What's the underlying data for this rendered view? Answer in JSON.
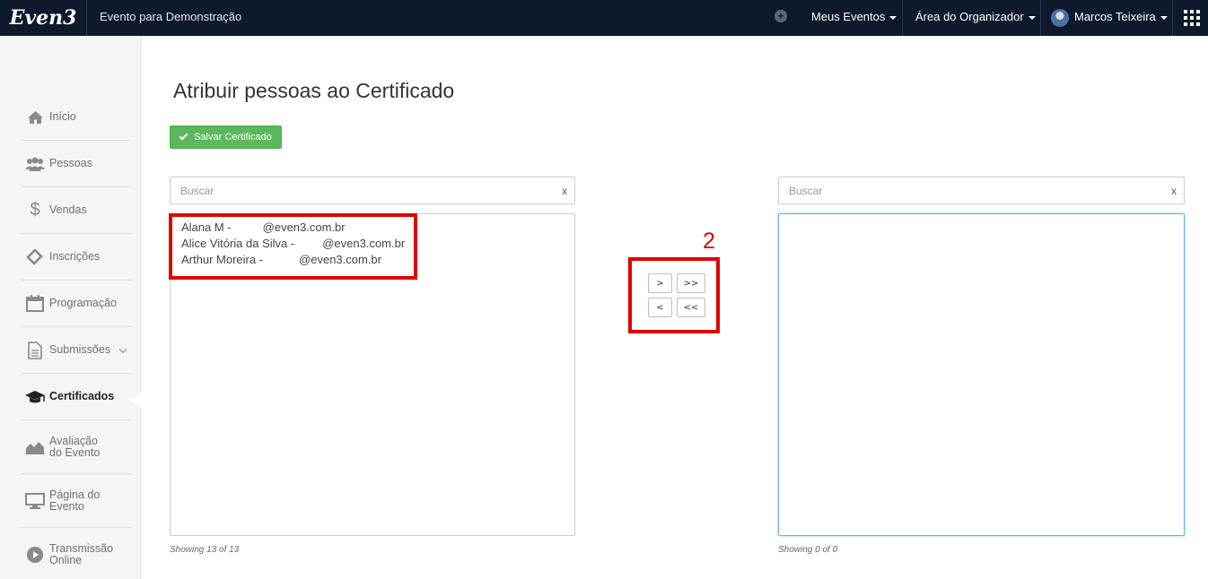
{
  "topbar": {
    "logo_text": "Even3",
    "event_title": "Evento para Demonstração",
    "nav": {
      "meus_eventos": "Meus Eventos",
      "area_organizador": "Área do Organizador",
      "user_name": "Marcos Teixeira"
    }
  },
  "sidebar": {
    "items": [
      {
        "label": "Início",
        "icon": "home-icon"
      },
      {
        "label": "Pessoas",
        "icon": "people-icon"
      },
      {
        "label": "Vendas",
        "icon": "dollar-icon"
      },
      {
        "label": "Inscrições",
        "icon": "ticket-icon"
      },
      {
        "label": "Programação",
        "icon": "calendar-icon"
      },
      {
        "label": "Submissões",
        "icon": "document-icon"
      },
      {
        "label": "Certificados",
        "icon": "graduation-cap-icon"
      },
      {
        "label_line1": "Avaliação",
        "label_line2": "do Evento",
        "icon": "area-chart-icon"
      },
      {
        "label_line1": "Página do",
        "label_line2": "Evento",
        "icon": "monitor-icon"
      },
      {
        "label_line1": "Transmissão",
        "label_line2": "Online",
        "icon": "play-circle-icon"
      }
    ]
  },
  "main": {
    "title": "Atribuir pessoas ao Certificado",
    "save_button": "Salvar Certificado",
    "left_panel": {
      "search_placeholder": "Buscar",
      "clear": "x",
      "items": [
        {
          "name": "Alana M -",
          "email": "@even3.com.br"
        },
        {
          "name": "Alice Vitória da Silva -",
          "email": "@even3.com.br"
        },
        {
          "name": "Arthur Moreira -",
          "email": "@even3.com.br"
        }
      ],
      "showing": "Showing 13 of 13"
    },
    "right_panel": {
      "search_placeholder": "Buscar",
      "clear": "x",
      "showing": "Showing 0 of 0"
    },
    "move_buttons": {
      "move_selected_right": ">",
      "move_all_right": ">>",
      "move_selected_left": "<",
      "move_all_left": "<<"
    },
    "annotation_number": "2"
  },
  "colors": {
    "topbar_bg": "#0e1a2b",
    "save_green": "#5cb85c",
    "highlight_red": "#e00000",
    "focus_blue": "#66afe9"
  }
}
